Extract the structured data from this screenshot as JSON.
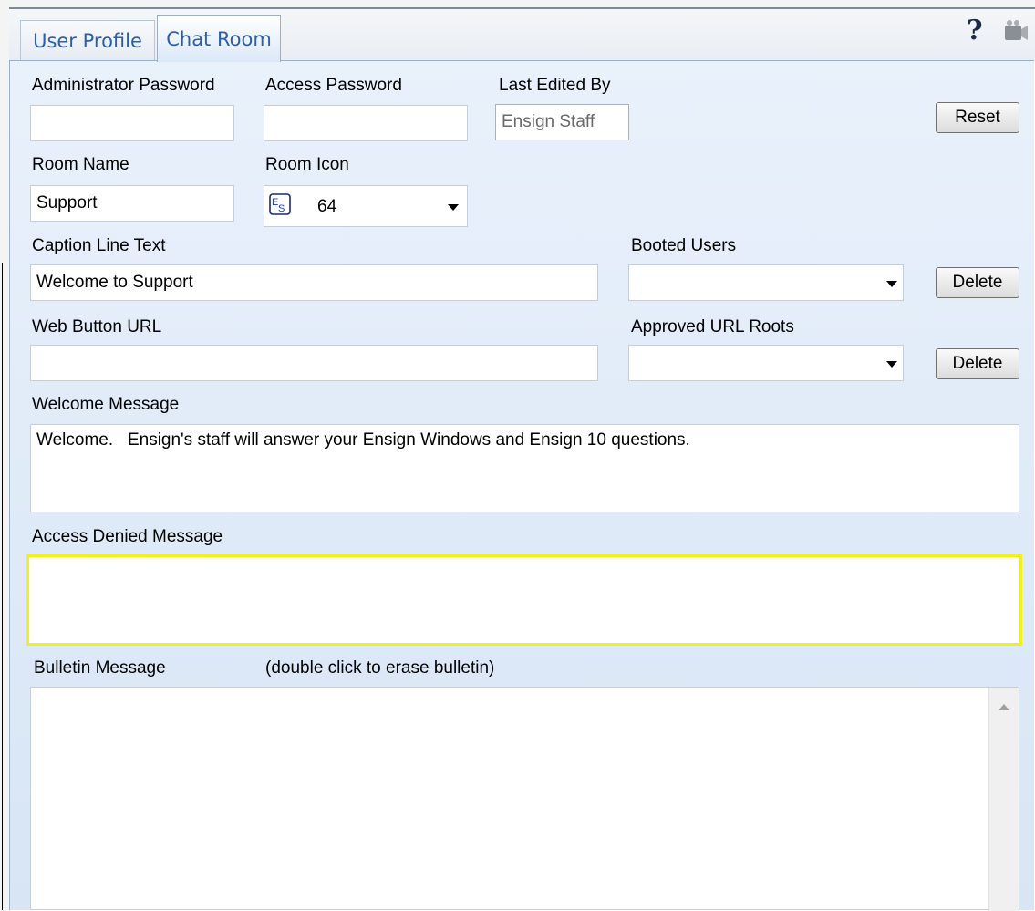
{
  "tabs": [
    {
      "label": "User Profile"
    },
    {
      "label": "Chat Room"
    }
  ],
  "toolbar": {
    "help_label": "?",
    "camera_icon": "camera-icon"
  },
  "fields": {
    "admin_password": {
      "label": "Administrator Password",
      "value": ""
    },
    "access_password": {
      "label": "Access Password",
      "value": ""
    },
    "last_edited_by": {
      "label": "Last Edited By",
      "value": "Ensign Staff"
    },
    "reset_label": "Reset",
    "room_name": {
      "label": "Room Name",
      "value": "Support"
    },
    "room_icon": {
      "label": "Room Icon",
      "value": "64",
      "icon": "es-logo-icon"
    },
    "caption_line": {
      "label": "Caption Line Text",
      "value": "Welcome to Support"
    },
    "booted_users": {
      "label": "Booted Users",
      "value": ""
    },
    "delete_label_1": "Delete",
    "web_button_url": {
      "label": "Web Button URL",
      "value": ""
    },
    "approved_url_roots": {
      "label": "Approved URL Roots",
      "value": ""
    },
    "delete_label_2": "Delete",
    "welcome_message": {
      "label": "Welcome Message",
      "value": "Welcome.   Ensign's staff will answer your Ensign Windows and Ensign 10 questions."
    },
    "access_denied_message": {
      "label": "Access Denied Message",
      "value": ""
    },
    "bulletin_message": {
      "label": "Bulletin Message",
      "hint": "(double click to erase bulletin)",
      "value": ""
    }
  },
  "colors": {
    "tab_text": "#2b5fa8",
    "panel_bg": "#dfeaf8",
    "focus_border": "#f0f020"
  }
}
